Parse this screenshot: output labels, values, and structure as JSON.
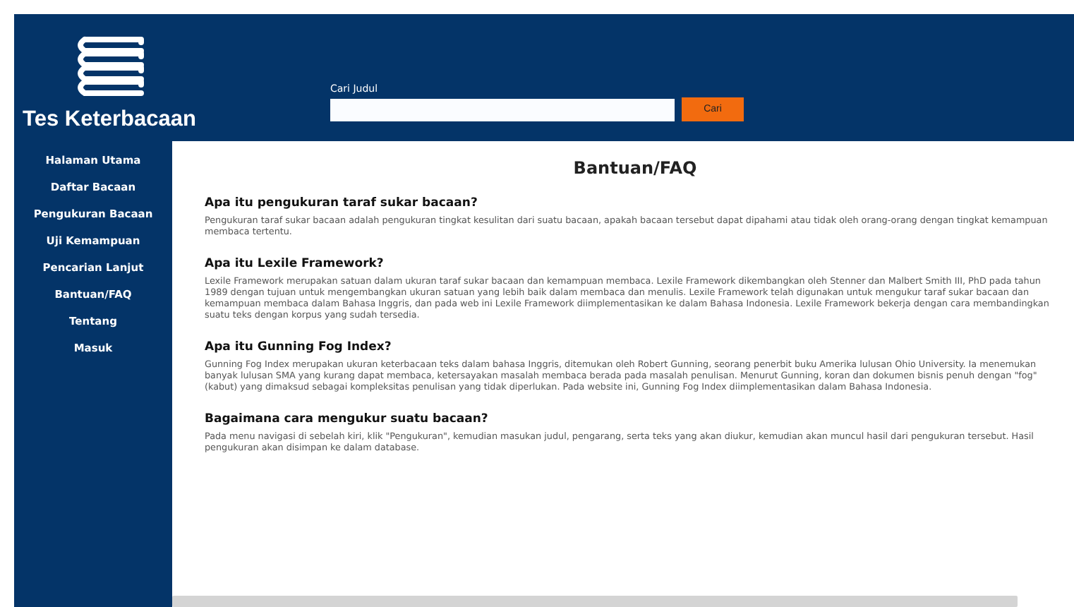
{
  "site": {
    "title": "Tes Keterbacaan"
  },
  "search": {
    "label": "Cari Judul",
    "button": "Cari"
  },
  "nav": [
    {
      "label": "Halaman Utama"
    },
    {
      "label": "Daftar Bacaan"
    },
    {
      "label": "Pengukuran Bacaan"
    },
    {
      "label": "Uji Kemampuan"
    },
    {
      "label": "Pencarian Lanjut"
    },
    {
      "label": "Bantuan/FAQ"
    },
    {
      "label": "Tentang"
    },
    {
      "label": "Masuk"
    }
  ],
  "page": {
    "title": "Bantuan/FAQ"
  },
  "faq": [
    {
      "question": "Apa itu pengukuran taraf sukar bacaan?",
      "answer": "Pengukuran taraf sukar bacaan adalah pengukuran tingkat kesulitan dari suatu bacaan, apakah bacaan tersebut dapat dipahami atau tidak oleh orang-orang dengan tingkat kemampuan membaca tertentu."
    },
    {
      "question": "Apa itu Lexile Framework?",
      "answer": "Lexile Framework merupakan satuan dalam ukuran taraf sukar bacaan dan kemampuan membaca. Lexile Framework dikembangkan oleh Stenner dan Malbert Smith III, PhD pada tahun 1989 dengan tujuan untuk mengembangkan ukuran satuan yang lebih baik dalam membaca dan menulis. Lexile Framework telah digunakan untuk mengukur taraf sukar bacaan dan kemampuan membaca dalam Bahasa Inggris, dan pada web ini Lexile Framework diimplementasikan ke dalam Bahasa Indonesia. Lexile Framework bekerja dengan cara membandingkan suatu teks dengan korpus yang sudah tersedia."
    },
    {
      "question": "Apa itu Gunning Fog Index?",
      "answer": "Gunning Fog Index merupakan ukuran keterbacaan teks dalam bahasa Inggris, ditemukan oleh Robert Gunning, seorang penerbit buku Amerika lulusan Ohio University. Ia menemukan banyak lulusan SMA yang kurang dapat membaca, ketersayakan masalah membaca berada pada masalah penulisan. Menurut Gunning, koran dan dokumen bisnis penuh dengan \"fog\" (kabut) yang dimaksud sebagai kompleksitas penulisan yang tidak diperlukan. Pada website ini, Gunning Fog Index diimplementasikan dalam Bahasa Indonesia."
    },
    {
      "question": "Bagaimana cara mengukur suatu bacaan?",
      "answer": "Pada menu navigasi di sebelah kiri, klik \"Pengukuran\", kemudian masukan judul, pengarang, serta teks yang akan diukur, kemudian akan muncul hasil dari pengukuran tersebut. Hasil pengukuran akan disimpan ke dalam database."
    }
  ]
}
